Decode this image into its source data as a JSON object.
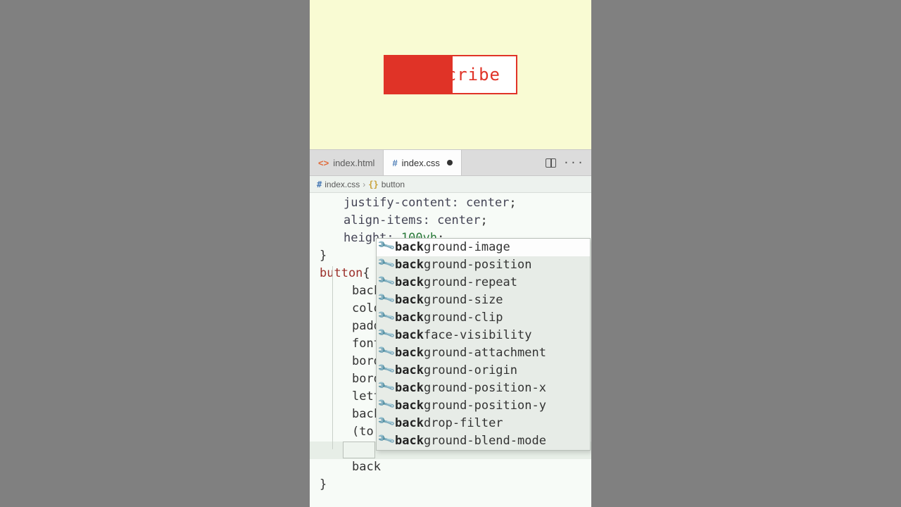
{
  "preview": {
    "button_text": "cribe"
  },
  "tabs": [
    {
      "icon": "<>",
      "label": "index.html"
    },
    {
      "icon": "#",
      "label": "index.css"
    }
  ],
  "crumbs": {
    "file_icon": "#",
    "file": "index.css",
    "sep": "›",
    "sel_icon": "{}",
    "selector": "button"
  },
  "code": {
    "l1_prop": "justify-content:",
    "l1_val": " center",
    "l1_end": ";",
    "l2_prop": "align-items:",
    "l2_val": " center",
    "l2_end": ";",
    "l3_prop": "height: ",
    "l3_num": "100vh",
    "l3_end": ";",
    "l4_close": "}",
    "l5_sel": "button",
    "l5_open": "{",
    "l6": "back",
    "l7": "colo",
    "l8": "padd",
    "l9": "font",
    "l10": "bord",
    "l11": "bord",
    "l12": "lett",
    "l13": "back",
    "l14": "(to ",
    "l15": ";",
    "l16": "back",
    "l17_close": "}"
  },
  "suggest": {
    "prefix": "back",
    "items": [
      "ground-image",
      "ground-position",
      "ground-repeat",
      "ground-size",
      "ground-clip",
      "face-visibility",
      "ground-attachment",
      "ground-origin",
      "ground-position-x",
      "ground-position-y",
      "drop-filter",
      "ground-blend-mode"
    ]
  }
}
